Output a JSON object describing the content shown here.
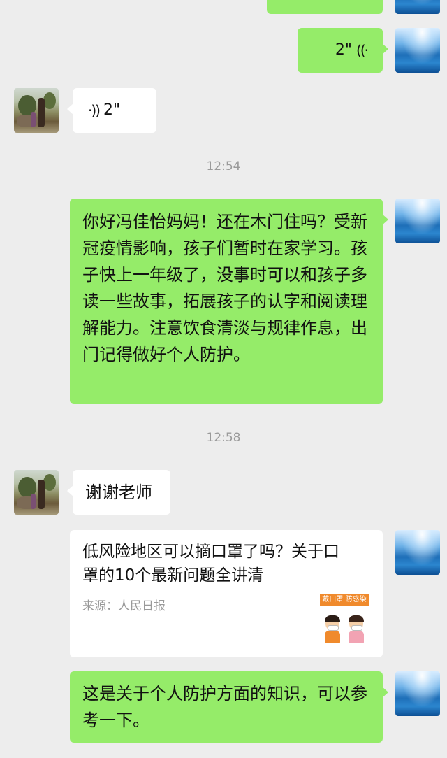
{
  "messages": {
    "voice_sent": {
      "duration": "2\"",
      "icon": "voice-wave-icon"
    },
    "voice_received": {
      "duration": "2\"",
      "icon": "voice-wave-icon"
    },
    "timestamp_1": "12:54",
    "long_sent": "你好冯佳怡妈妈！还在木门住吗？受新冠疫情影响，孩子们暂时在家学习。孩子快上一年级了，没事时可以和孩子多读一些故事，拓展孩子的认字和阅读理解能力。注意饮食清淡与规律作息，出门记得做好个人防护。",
    "timestamp_2": "12:58",
    "thanks_received": "谢谢老师",
    "article_card": {
      "title": "低风险地区可以摘口罩了吗？关于口罩的10个最新问题全讲清",
      "source": "来源：人民日报",
      "thumb_banner": "戴口罩 防感染"
    },
    "last_sent": "这是关于个人防护方面的知识，可以参考一下。"
  },
  "colors": {
    "sent_bubble": "#95ec69",
    "received_bubble": "#ffffff",
    "background": "#ededed",
    "timestamp": "#9a9a9a"
  }
}
